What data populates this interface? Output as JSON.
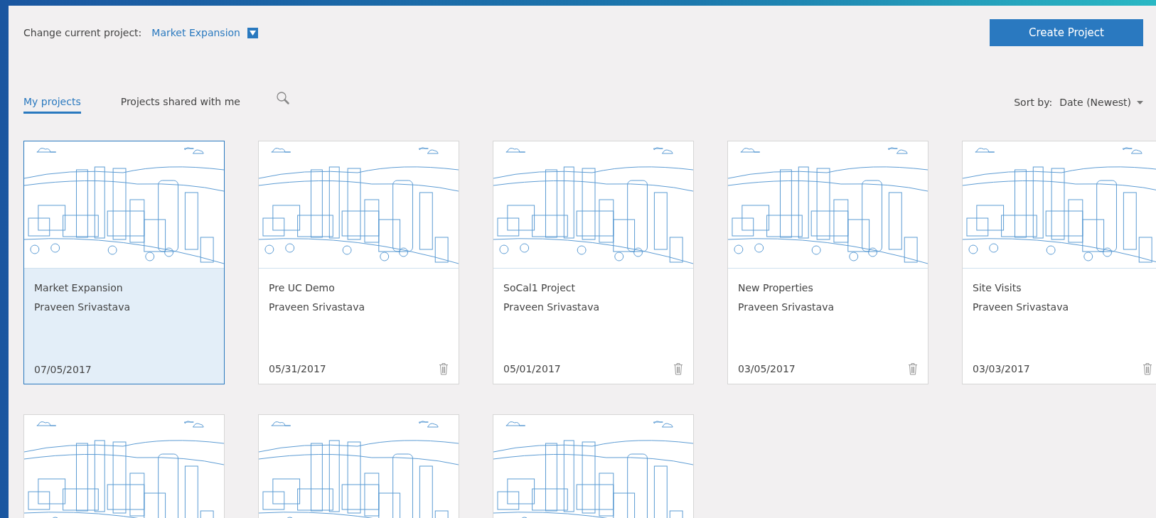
{
  "header": {
    "label": "Change current project:",
    "current_project": "Market Expansion",
    "create_button": "Create Project"
  },
  "tabs": [
    {
      "label": "My projects",
      "selected": true
    },
    {
      "label": "Projects shared with me",
      "selected": false
    }
  ],
  "sort": {
    "label": "Sort by:",
    "value": "Date (Newest)"
  },
  "projects": [
    {
      "title": "Market Expansion",
      "owner": "Praveen Srivastava",
      "date": "07/05/2017",
      "selected": true
    },
    {
      "title": "Pre UC Demo",
      "owner": "Praveen Srivastava",
      "date": "05/31/2017",
      "selected": false
    },
    {
      "title": "SoCal1 Project",
      "owner": "Praveen Srivastava",
      "date": "05/01/2017",
      "selected": false
    },
    {
      "title": "New Properties",
      "owner": "Praveen Srivastava",
      "date": "03/05/2017",
      "selected": false
    },
    {
      "title": "Site Visits",
      "owner": "Praveen Srivastava",
      "date": "03/03/2017",
      "selected": false
    },
    {
      "selected": false
    },
    {
      "selected": false
    },
    {
      "selected": false
    }
  ]
}
